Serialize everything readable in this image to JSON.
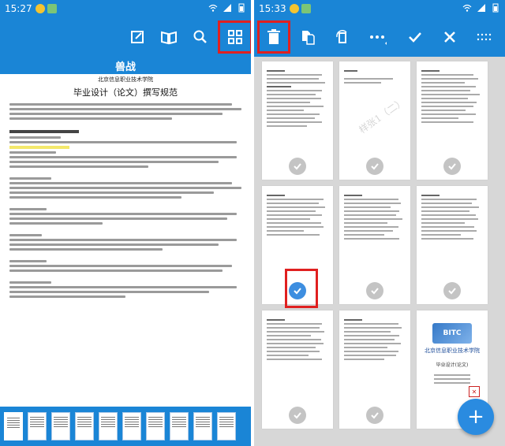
{
  "left": {
    "status": {
      "time": "15:27"
    },
    "document": {
      "title": "兽战",
      "school": "北京信息职业技术学院",
      "heading": "毕业设计（论文）撰写规范"
    },
    "toolbar": {
      "edit": "edit-icon",
      "read": "book-icon",
      "search": "search-icon",
      "grid": "grid-icon"
    }
  },
  "right": {
    "status": {
      "time": "15:33"
    },
    "toolbar": {
      "delete": "trash-icon",
      "copy": "copy-icon",
      "rotate": "rotate-icon",
      "more": "more-icon",
      "confirm": "check-icon",
      "close": "close-icon",
      "menu": "menu-icon"
    },
    "cards": [
      {
        "id": 1,
        "checked": false,
        "type": "text"
      },
      {
        "id": 2,
        "checked": false,
        "type": "watermark",
        "watermark": "样张1（二）"
      },
      {
        "id": 3,
        "checked": false,
        "type": "text"
      },
      {
        "id": 4,
        "checked": true,
        "type": "text"
      },
      {
        "id": 5,
        "checked": false,
        "type": "text"
      },
      {
        "id": 6,
        "checked": false,
        "type": "text"
      },
      {
        "id": 7,
        "checked": false,
        "type": "text"
      },
      {
        "id": 8,
        "checked": false,
        "type": "text"
      },
      {
        "id": 9,
        "checked": false,
        "type": "cover",
        "logo": "BITC",
        "school": "北京信息职业技术学院",
        "caption": "毕业设计(论文)"
      }
    ],
    "fab": "+"
  },
  "colors": {
    "accent": "#1a85d6",
    "highlight": "#e02020",
    "check_on": "#3d8ee0",
    "check_off": "#c4c4c4"
  }
}
